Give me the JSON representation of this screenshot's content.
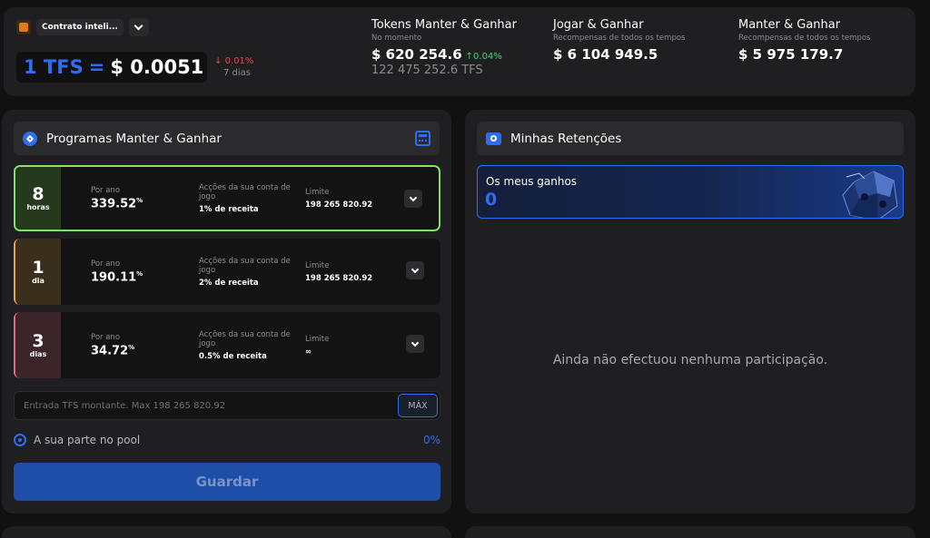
{
  "header": {
    "contract_label": "Contrato inteli...",
    "price": {
      "token": "1 TFS",
      "equals": "=",
      "value": "$ 0.0051",
      "change": "0.01%",
      "period": "7 dias"
    },
    "stats": [
      {
        "title": "Tokens Manter & Ganhar",
        "subtitle": "No momento",
        "value": "$ 620 254.6",
        "delta": "0.04%",
        "extra": "122 475 252.6 TFS"
      },
      {
        "title": "Jogar & Ganhar",
        "subtitle": "Recompensas de todos os tempos",
        "value": "$ 6 104 949.5"
      },
      {
        "title": "Manter & Ganhar",
        "subtitle": "Recompensas de todos os tempos",
        "value": "$ 5 975 179.7"
      }
    ]
  },
  "programs": {
    "title": "Programas Manter & Ganhar",
    "items": [
      {
        "num": "8",
        "unit": "horas",
        "color": "#25391c",
        "per_year_label": "Por ano",
        "rate": "339.52",
        "rate_suffix": "%",
        "actions_label": "Acções da sua conta de jogo",
        "revenue": "1% de receita",
        "limit_label": "Limite",
        "limit": "198 265 820.92",
        "active": true
      },
      {
        "num": "1",
        "unit": "dia",
        "color": "#3a2e1c",
        "per_year_label": "Por ano",
        "rate": "190.11",
        "rate_suffix": "%",
        "actions_label": "Acções da sua conta de jogo",
        "revenue": "2% de receita",
        "limit_label": "Limite",
        "limit": "198 265 820.92",
        "active": false
      },
      {
        "num": "3",
        "unit": "dias",
        "color": "#3b242a",
        "per_year_label": "Por ano",
        "rate": "34.72",
        "rate_suffix": "%",
        "actions_label": "Acções da sua conta de jogo",
        "revenue": "0.5% de receita",
        "limit_label": "Limite",
        "limit": "∞",
        "active": false
      }
    ],
    "accent_colors": [
      "#7fe06a",
      "#e0a54a",
      "#e06a80"
    ],
    "input_placeholder": "Entrada TFS montante. Max 198 265 820.92",
    "max_label": "MÁX",
    "pool_label": "A sua parte no pool",
    "pool_value": "0%",
    "save_label": "Guardar"
  },
  "holdings": {
    "title": "Minhas Retenções",
    "gains_label": "Os meus ganhos",
    "gains_value": "0",
    "empty_message": "Ainda não efectuou nenhuma participação."
  },
  "colors": {
    "accent_blue": "#2f6cf5",
    "negative": "#e0484a",
    "positive": "#3ed36a"
  }
}
